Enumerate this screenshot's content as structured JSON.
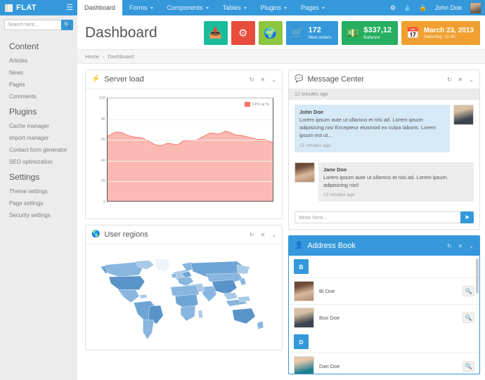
{
  "brand": {
    "name": "FLAT",
    "logo_icon": "book-icon",
    "menu_icon": "hamburger-icon"
  },
  "topnav": {
    "items": [
      {
        "label": "Dashboard",
        "active": true,
        "has_caret": false
      },
      {
        "label": "Forms",
        "active": false,
        "has_caret": true
      },
      {
        "label": "Components",
        "active": false,
        "has_caret": true
      },
      {
        "label": "Tables",
        "active": false,
        "has_caret": true
      },
      {
        "label": "Plugins",
        "active": false,
        "has_caret": true
      },
      {
        "label": "Pages",
        "active": false,
        "has_caret": true
      }
    ],
    "icons": [
      "gear-icon",
      "droplet-icon",
      "lock-icon"
    ],
    "user_name": "John Doe",
    "avatar": "user-avatar"
  },
  "sidebar": {
    "search_placeholder": "Search here...",
    "search_icon": "search-icon",
    "groups": [
      {
        "heading": "Content",
        "items": [
          "Articles",
          "News",
          "Pages",
          "Comments"
        ]
      },
      {
        "heading": "Plugins",
        "items": [
          "Cache manager",
          "Import manager",
          "Contact form generator",
          "SEO optimization"
        ]
      },
      {
        "heading": "Settings",
        "items": [
          "Theme settings",
          "Page settings",
          "Security settings"
        ]
      }
    ]
  },
  "page": {
    "title": "Dashboard",
    "breadcrumb": {
      "home": "Home",
      "separator": "›",
      "current": "Dashboard"
    }
  },
  "tiles": [
    {
      "kind": "square",
      "icon": "inbox-icon",
      "color": "#1abc9c",
      "value": "",
      "label": ""
    },
    {
      "kind": "square",
      "icon": "cogs-icon",
      "color": "#e74c3c",
      "value": "",
      "label": ""
    },
    {
      "kind": "square",
      "icon": "globe-icon",
      "color": "#8cc63e",
      "value": "",
      "label": ""
    },
    {
      "kind": "wide",
      "icon": "shopping-cart-icon",
      "color": "#3498db",
      "value": "172",
      "label": "New orders"
    },
    {
      "kind": "wide",
      "icon": "money-icon",
      "color": "#27ae60",
      "value": "$337,12",
      "label": "Balance"
    },
    {
      "kind": "wide-date",
      "icon": "calendar-icon",
      "color": "#f0a030",
      "value": "March 23, 2013",
      "label": "Saturday, 11:30"
    }
  ],
  "panels": {
    "server_load": {
      "title": "Server load",
      "icon": "bolt-icon",
      "tools": [
        "refresh-icon",
        "close-icon",
        "chevron-down-icon"
      ]
    },
    "user_regions": {
      "title": "User regions",
      "icon": "globe-icon",
      "tools": [
        "refresh-icon",
        "close-icon",
        "chevron-down-icon"
      ]
    },
    "message_center": {
      "title": "Message Center",
      "icon": "comment-icon",
      "tools": [
        "refresh-icon",
        "close-icon",
        "chevron-down-icon"
      ],
      "top_time": "12 minutes ago",
      "messages": [
        {
          "author": "John Doe",
          "text": "Lorem ipsum aute ut ullamco et nisi ad. Lorem ipsum adipisicing nisi Excepteur eiusmod ex culpa laboris. Lorem ipsum est ut...",
          "time": "12 minutes ago",
          "side": "right",
          "avatar": "john-doe-avatar"
        },
        {
          "author": "Jane Doe",
          "text": "Lorem ipsum aute ut ullamco et nisi ad. Lorem ipsum adipisicing nisi!",
          "time": "12 minutes ago",
          "side": "left",
          "avatar": "jane-doe-avatar"
        }
      ],
      "compose_placeholder": "Write here...",
      "send_icon": "send-arrow-icon"
    },
    "address_book": {
      "title": "Address Book",
      "icon": "user-icon",
      "tools": [
        "refresh-icon",
        "close-icon",
        "chevron-down-icon"
      ],
      "sections": [
        {
          "letter": "B",
          "contacts": [
            {
              "name": "Bi Doe",
              "avatar": "bi-doe-avatar",
              "action_icon": "search-icon"
            },
            {
              "name": "Boo Doe",
              "avatar": "boo-doe-avatar",
              "action_icon": "search-icon"
            }
          ]
        },
        {
          "letter": "D",
          "contacts": [
            {
              "name": "Dan Doe",
              "avatar": "dan-doe-avatar",
              "action_icon": "search-icon"
            }
          ]
        }
      ]
    }
  },
  "chart_data": {
    "type": "area",
    "title": "Server load",
    "xlabel": "",
    "ylabel": "",
    "ylim": [
      0,
      100
    ],
    "yticks": [
      0,
      20,
      40,
      60,
      80,
      100
    ],
    "grid": true,
    "legend": {
      "position": "top-right",
      "entries": [
        "CPU at %"
      ]
    },
    "series": [
      {
        "name": "CPU at %",
        "color": "#fa7268",
        "fill": "#fab9b3",
        "values": [
          63,
          65,
          67,
          67,
          66,
          64,
          63,
          62,
          62,
          61,
          59,
          57,
          55,
          54,
          54,
          56,
          56,
          55,
          55,
          58,
          59,
          59,
          59,
          60,
          62,
          64,
          66,
          66,
          65,
          66,
          68,
          67,
          65,
          64,
          64,
          63,
          62,
          61,
          60,
          60,
          60,
          58,
          57
        ]
      }
    ]
  },
  "map_data": {
    "type": "choropleth",
    "title": "User regions",
    "palette": [
      "#dce9f5",
      "#a9c9e8",
      "#89b6de",
      "#6ea5d4",
      "#5a93c8"
    ]
  }
}
